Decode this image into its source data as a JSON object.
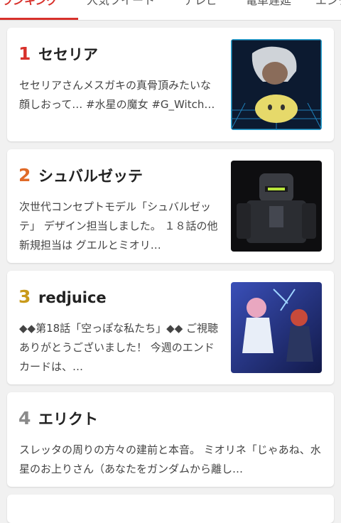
{
  "tabs": [
    {
      "label": "ランキング",
      "active": true
    },
    {
      "label": "人気ツイート",
      "active": false
    },
    {
      "label": "テレビ",
      "active": false
    },
    {
      "label": "電車遅延",
      "active": false
    },
    {
      "label": "エンタ",
      "active": false
    }
  ],
  "colors": {
    "accent": "#d8312b",
    "rank1": "#d8312b",
    "rank2": "#e06a28",
    "rank3": "#c99a1b",
    "rank4": "#8a8a8a"
  },
  "items": [
    {
      "rank": "1",
      "title": "セセリア",
      "desc": "セセリアさんメスガキの真骨頂みたいな顔しおって… #水星の魔女 #G_Witch…"
    },
    {
      "rank": "2",
      "title": "シュバルゼッテ",
      "desc": "次世代コンセプトモデル「シュバルゼッテ」 デザイン担当しました。 １８話の他新規担当は グエルとミオリ…"
    },
    {
      "rank": "3",
      "title": "redjuice",
      "desc": "◆◆第18話「空っぽな私たち」◆◆ ご視聴ありがとうございました！ 今週のエンドカードは、…"
    },
    {
      "rank": "4",
      "title": "エリクト",
      "desc": "スレッタの周りの方々の建前と本音。 ミオリネ「じゃあね、水星のお上りさん（あなたをガンダムから離し…"
    }
  ]
}
